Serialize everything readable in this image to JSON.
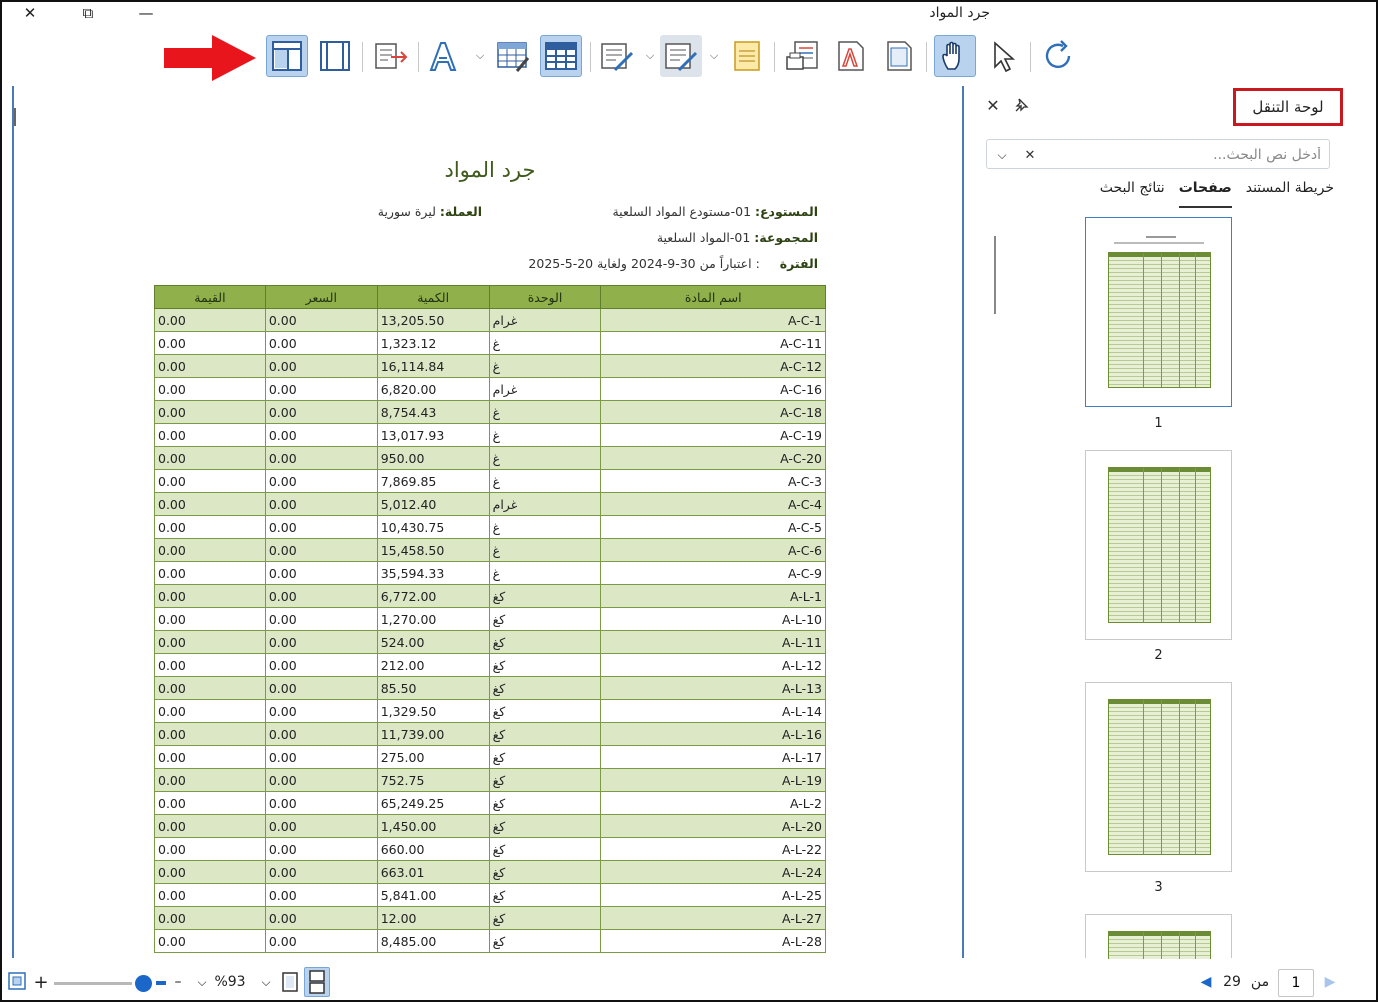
{
  "window": {
    "title": "جرد المواد",
    "close": "✕",
    "restore": "⧉",
    "minimize": "—"
  },
  "toolbar": {
    "buttons": [
      "single-page-view",
      "page-width-view",
      "export",
      "font",
      "table-layout",
      "table-grid",
      "edit-report",
      "design-report",
      "page-setup",
      "print",
      "pdf-export",
      "page-view",
      "hand-tool",
      "select-tool",
      "refresh"
    ]
  },
  "document": {
    "title": "جرد المواد",
    "warehouse_label": "المستودع:",
    "warehouse_value": "01-مستودع المواد السلعية",
    "currency_label": "العملة:",
    "currency_value": "ليرة سورية",
    "group_label": "المجموعة:",
    "group_value": "01-المواد السلعية",
    "period_label": "الفترة",
    "period_value": ": اعتباراً من 30-9-2024 ولغاية 20-5-2025",
    "columns": [
      "اسم المادة",
      "الوحدة",
      "الكمية",
      "السعر",
      "القيمة"
    ],
    "rows": [
      [
        "A-C-1",
        "غرام",
        "13,205.50",
        "0.00",
        "0.00"
      ],
      [
        "A-C-11",
        "غ",
        "1,323.12",
        "0.00",
        "0.00"
      ],
      [
        "A-C-12",
        "غ",
        "16,114.84",
        "0.00",
        "0.00"
      ],
      [
        "A-C-16",
        "غرام",
        "6,820.00",
        "0.00",
        "0.00"
      ],
      [
        "A-C-18",
        "غ",
        "8,754.43",
        "0.00",
        "0.00"
      ],
      [
        "A-C-19",
        "غ",
        "13,017.93",
        "0.00",
        "0.00"
      ],
      [
        "A-C-20",
        "غ",
        "950.00",
        "0.00",
        "0.00"
      ],
      [
        "A-C-3",
        "غ",
        "7,869.85",
        "0.00",
        "0.00"
      ],
      [
        "A-C-4",
        "غرام",
        "5,012.40",
        "0.00",
        "0.00"
      ],
      [
        "A-C-5",
        "غ",
        "10,430.75",
        "0.00",
        "0.00"
      ],
      [
        "A-C-6",
        "غ",
        "15,458.50",
        "0.00",
        "0.00"
      ],
      [
        "A-C-9",
        "غ",
        "35,594.33",
        "0.00",
        "0.00"
      ],
      [
        "A-L-1",
        "كغ",
        "6,772.00",
        "0.00",
        "0.00"
      ],
      [
        "A-L-10",
        "كغ",
        "1,270.00",
        "0.00",
        "0.00"
      ],
      [
        "A-L-11",
        "كغ",
        "524.00",
        "0.00",
        "0.00"
      ],
      [
        "A-L-12",
        "كغ",
        "212.00",
        "0.00",
        "0.00"
      ],
      [
        "A-L-13",
        "كغ",
        "85.50",
        "0.00",
        "0.00"
      ],
      [
        "A-L-14",
        "كغ",
        "1,329.50",
        "0.00",
        "0.00"
      ],
      [
        "A-L-16",
        "كغ",
        "11,739.00",
        "0.00",
        "0.00"
      ],
      [
        "A-L-17",
        "كغ",
        "275.00",
        "0.00",
        "0.00"
      ],
      [
        "A-L-19",
        "كغ",
        "752.75",
        "0.00",
        "0.00"
      ],
      [
        "A-L-2",
        "كغ",
        "65,249.25",
        "0.00",
        "0.00"
      ],
      [
        "A-L-20",
        "كغ",
        "1,450.00",
        "0.00",
        "0.00"
      ],
      [
        "A-L-22",
        "كغ",
        "660.00",
        "0.00",
        "0.00"
      ],
      [
        "A-L-24",
        "كغ",
        "663.01",
        "0.00",
        "0.00"
      ],
      [
        "A-L-25",
        "كغ",
        "5,841.00",
        "0.00",
        "0.00"
      ],
      [
        "A-L-27",
        "كغ",
        "12.00",
        "0.00",
        "0.00"
      ],
      [
        "A-L-28",
        "كغ",
        "8,485.00",
        "0.00",
        "0.00"
      ]
    ]
  },
  "navpane": {
    "title": "لوحة التنقل",
    "search_placeholder": "أدخل نص البحث...",
    "tabs": [
      "خريطة المستند",
      "صفحات",
      "نتائج البحث"
    ],
    "active_tab": "صفحات",
    "pages": [
      "1",
      "2",
      "3"
    ]
  },
  "statusbar": {
    "zoom": "%93",
    "page_current": "1",
    "of_label": "من",
    "page_total": "29"
  },
  "colors": {
    "header": "#8fb04b",
    "alt_row": "#dce7c6",
    "accent": "#1a67c9",
    "highlight": "#c8191f"
  }
}
